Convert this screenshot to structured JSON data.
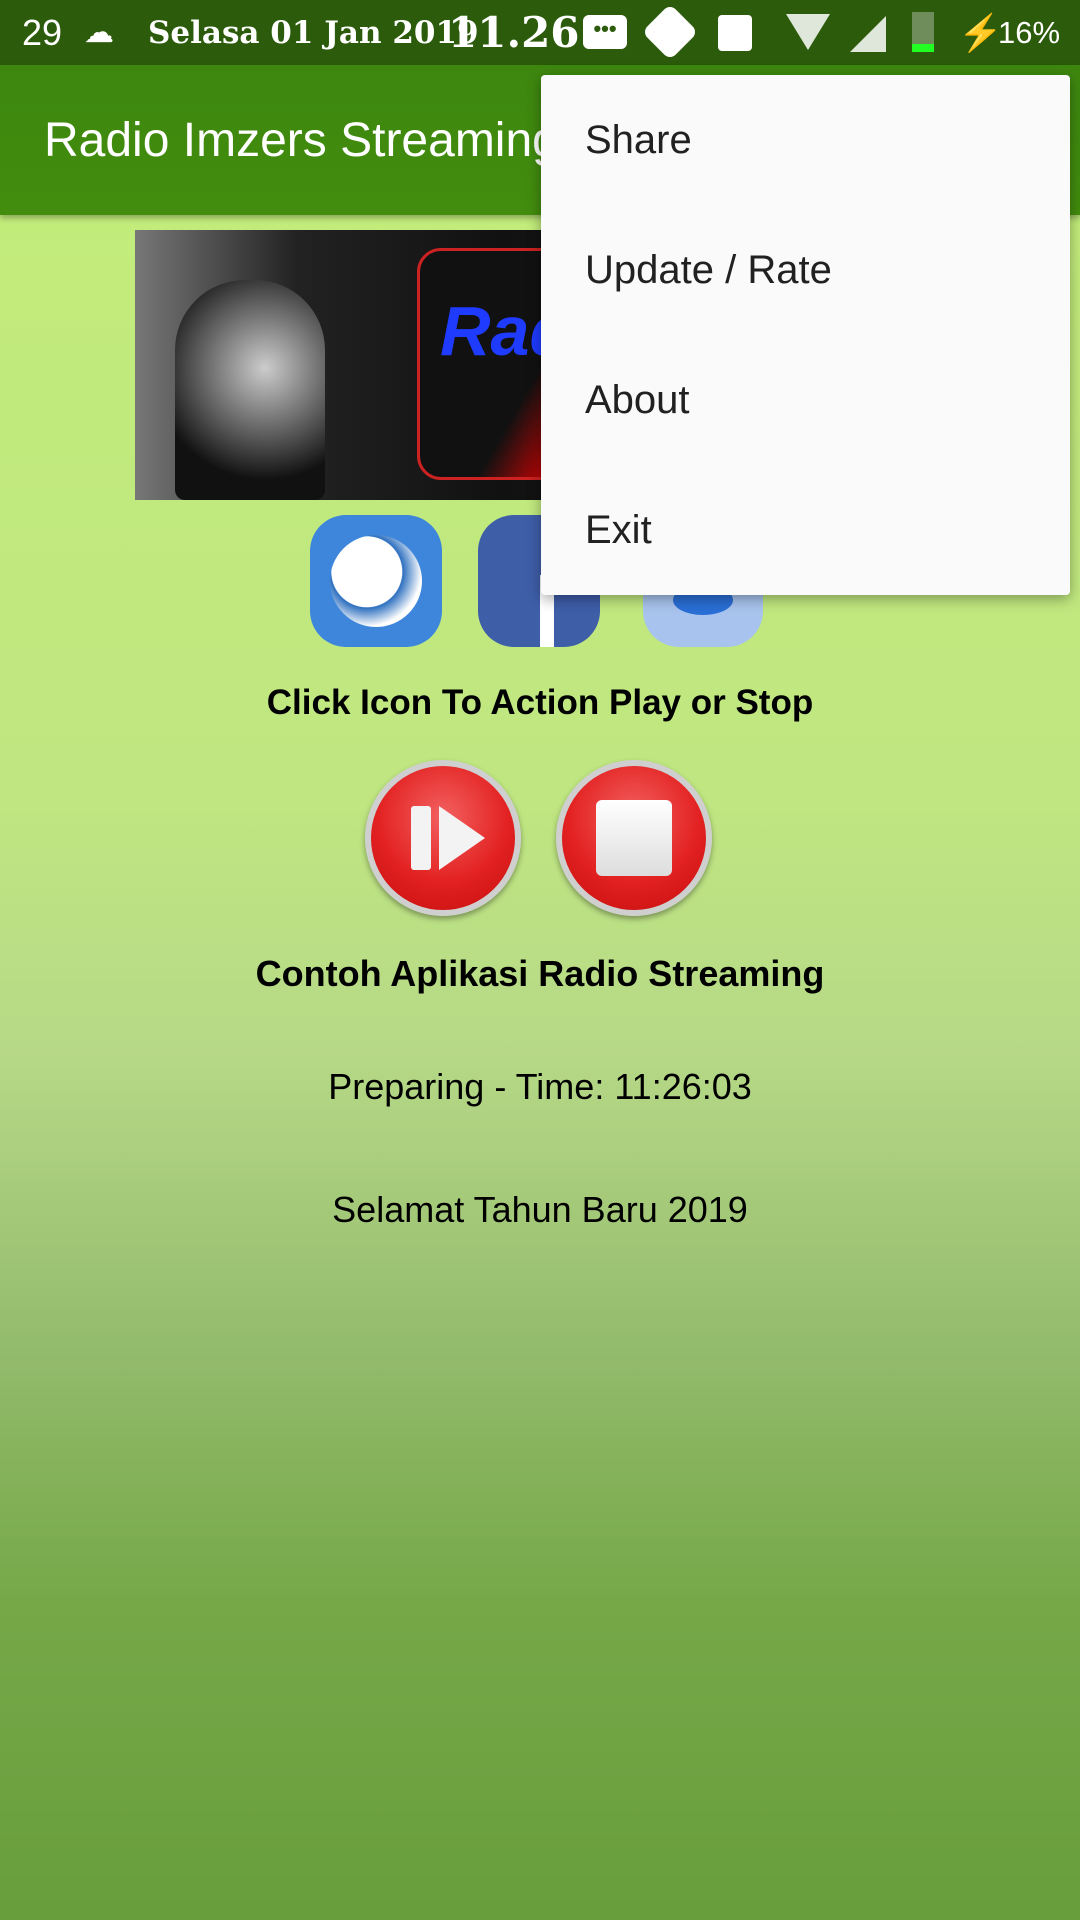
{
  "status_bar": {
    "temperature": "29",
    "weather_icon": "cloud-moon-icon",
    "date": "Selasa 01 Jan 2019",
    "time": "11.26",
    "battery": "16%",
    "icons": [
      "message-icon",
      "gear-icon",
      "image-icon",
      "wifi-icon",
      "signal-icon",
      "battery-icon",
      "charging-icon"
    ]
  },
  "app_bar": {
    "title": "Radio Imzers Streaming",
    "color": "#3f8a0e"
  },
  "menu": {
    "items": [
      {
        "label": "Share"
      },
      {
        "label": "Update / Rate"
      },
      {
        "label": "About"
      },
      {
        "label": "Exit"
      }
    ]
  },
  "banner": {
    "logo_text": "Radio Imzers"
  },
  "social_icons": [
    "globe-icon",
    "facebook-icon",
    "messenger-icon"
  ],
  "main": {
    "instruction": "Click Icon To Action Play or Stop",
    "app_name": "Contoh Aplikasi Radio Streaming",
    "status": "Preparing - Time: 11:26:03",
    "message": "Selamat Tahun Baru 2019"
  }
}
